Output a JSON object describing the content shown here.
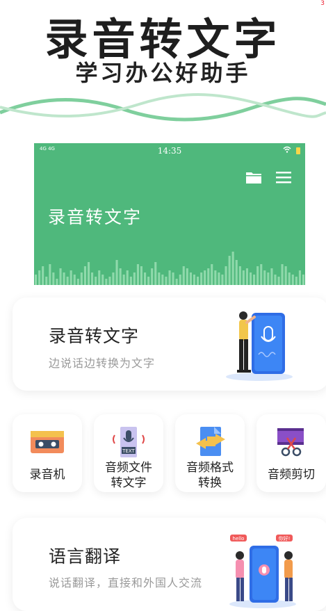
{
  "hero": {
    "title": "录音转文字",
    "subtitle": "学习办公好助手",
    "corner_mark": "3"
  },
  "phone_preview": {
    "status_signal": "4G 4G",
    "status_time": "14:35",
    "title": "录音转文字",
    "waveform_levels": [
      0.25,
      0.35,
      0.45,
      0.2,
      0.5,
      0.3,
      0.15,
      0.4,
      0.3,
      0.2,
      0.35,
      0.25,
      0.15,
      0.3,
      0.45,
      0.55,
      0.3,
      0.2,
      0.35,
      0.25,
      0.15,
      0.2,
      0.3,
      0.6,
      0.4,
      0.25,
      0.35,
      0.2,
      0.3,
      0.5,
      0.45,
      0.3,
      0.2,
      0.4,
      0.55,
      0.3,
      0.25,
      0.2,
      0.35,
      0.3,
      0.15,
      0.25,
      0.45,
      0.4,
      0.3,
      0.25,
      0.2,
      0.3,
      0.35,
      0.4,
      0.5,
      0.35,
      0.3,
      0.25,
      0.45,
      0.7,
      0.8,
      0.6,
      0.45,
      0.35,
      0.4,
      0.3,
      0.25,
      0.45,
      0.5,
      0.35,
      0.3,
      0.4,
      0.25,
      0.2,
      0.5,
      0.45,
      0.3,
      0.25,
      0.2,
      0.35,
      0.25
    ]
  },
  "feature_record": {
    "title": "录音转文字",
    "subtitle": "边说话边转换为文字"
  },
  "tools": [
    {
      "label": "录音机",
      "icon": "cassette-icon"
    },
    {
      "label": "音频文件\n转文字",
      "icon": "audio-text-icon"
    },
    {
      "label": "音频格式\n转换",
      "icon": "format-convert-icon"
    },
    {
      "label": "音频剪切",
      "icon": "film-cut-icon"
    }
  ],
  "feature_translate": {
    "title": "语言翻译",
    "subtitle": "说话翻译，直接和外国人交流",
    "bubble1": "hello",
    "bubble2": "你好!"
  },
  "colors": {
    "brand_green": "#4fb87c",
    "accent_blue": "#3a7df2"
  }
}
